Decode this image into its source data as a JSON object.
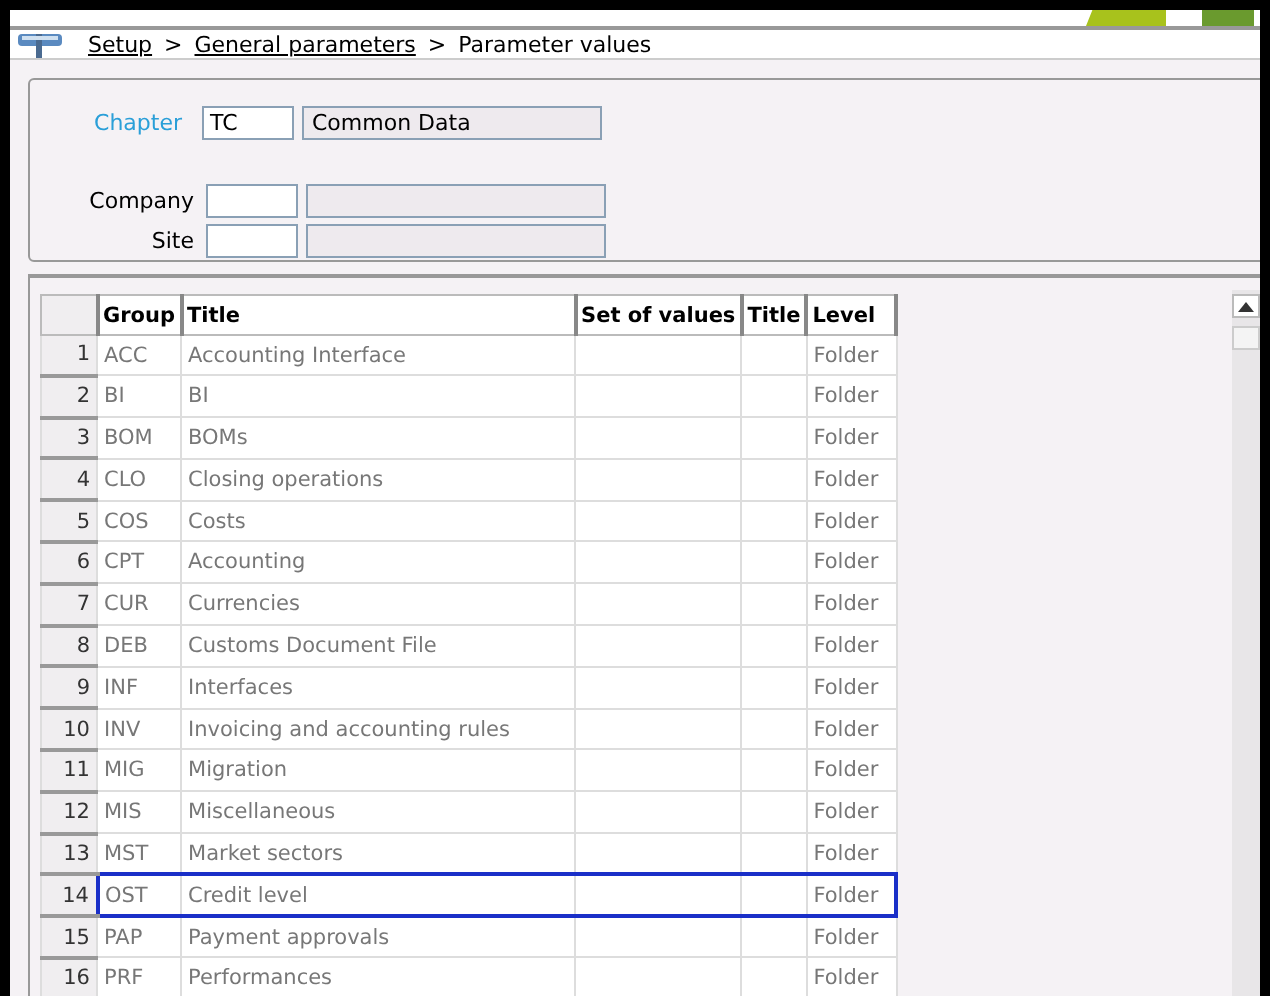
{
  "breadcrumb": [
    {
      "label": "Setup",
      "link": true
    },
    {
      "label": "General parameters",
      "link": true
    },
    {
      "label": "Parameter values",
      "link": false
    }
  ],
  "breadcrumb_separator": ">",
  "form": {
    "chapter": {
      "label": "Chapter",
      "code": "TC",
      "description": "Common Data"
    },
    "fields": [
      {
        "label": "Company"
      },
      {
        "label": "Site"
      }
    ]
  },
  "table": {
    "columns": [
      "Group",
      "Title",
      "Set of values",
      "Title",
      "Level"
    ],
    "rows": [
      {
        "number": "1",
        "group": "ACC",
        "title": "Accounting Interface",
        "level": "Folder",
        "selected": false
      },
      {
        "number": "2",
        "group": "BI",
        "title": "BI",
        "level": "Folder",
        "selected": false
      },
      {
        "number": "3",
        "group": "BOM",
        "title": "BOMs",
        "level": "Folder",
        "selected": false
      },
      {
        "number": "4",
        "group": "CLO",
        "title": "Closing operations",
        "level": "Folder",
        "selected": false
      },
      {
        "number": "5",
        "group": "COS",
        "title": "Costs",
        "level": "Folder",
        "selected": false
      },
      {
        "number": "6",
        "group": "CPT",
        "title": "Accounting",
        "level": "Folder",
        "selected": false
      },
      {
        "number": "7",
        "group": "CUR",
        "title": "Currencies",
        "level": "Folder",
        "selected": false
      },
      {
        "number": "8",
        "group": "DEB",
        "title": "Customs Document File",
        "level": "Folder",
        "selected": false
      },
      {
        "number": "9",
        "group": "INF",
        "title": "Interfaces",
        "level": "Folder",
        "selected": false
      },
      {
        "number": "10",
        "group": "INV",
        "title": "Invoicing and accounting rules",
        "level": "Folder",
        "selected": false
      },
      {
        "number": "11",
        "group": "MIG",
        "title": "Migration",
        "level": "Folder",
        "selected": false
      },
      {
        "number": "12",
        "group": "MIS",
        "title": "Miscellaneous",
        "level": "Folder",
        "selected": false
      },
      {
        "number": "13",
        "group": "MST",
        "title": "Market sectors",
        "level": "Folder",
        "selected": false
      },
      {
        "number": "14",
        "group": "OST",
        "title": "Credit level",
        "level": "Folder",
        "selected": true
      },
      {
        "number": "15",
        "group": "PAP",
        "title": "Payment approvals",
        "level": "Folder",
        "selected": false
      },
      {
        "number": "16",
        "group": "PRF",
        "title": "Performances",
        "level": "Folder",
        "selected": false
      }
    ]
  }
}
